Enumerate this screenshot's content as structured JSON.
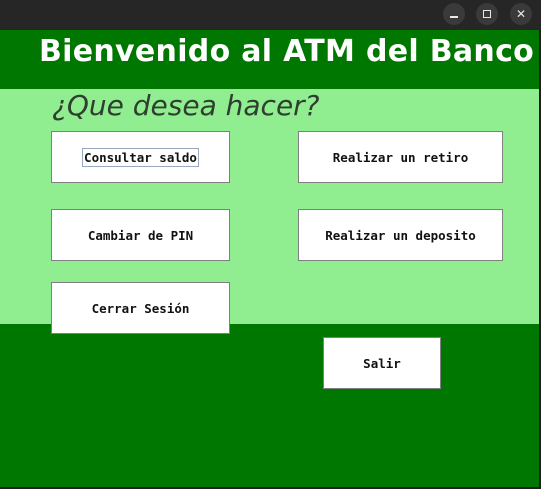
{
  "window": {
    "controls": {
      "minimize_icon": "minimize-icon",
      "maximize_icon": "maximize-icon",
      "close_icon": "close-icon",
      "close_glyph": "✕"
    }
  },
  "header": {
    "title": "Bienvenido al ATM del Banco"
  },
  "menu": {
    "prompt": "¿Que desea hacer?",
    "buttons": {
      "consultar_saldo": "Consultar saldo",
      "realizar_retiro": "Realizar un retiro",
      "cambiar_pin": "Cambiar de PIN",
      "realizar_deposito": "Realizar un deposito",
      "cerrar_sesion": "Cerrar Sesión"
    }
  },
  "footer": {
    "salir": "Salir"
  },
  "colors": {
    "header_bg": "#007700",
    "panel_bg": "#90ee90",
    "button_bg": "#ffffff",
    "prompt_text": "#2f3f2f"
  }
}
